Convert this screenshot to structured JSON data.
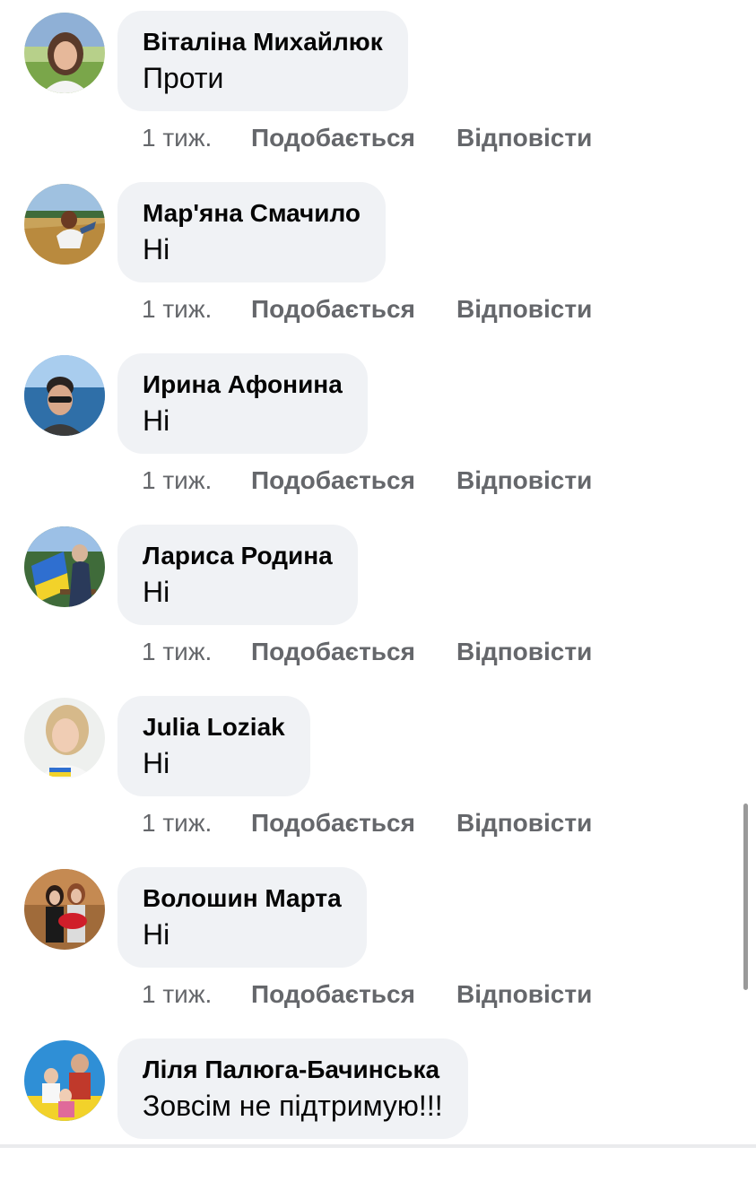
{
  "comments": [
    {
      "author": "Віталіна Михайлюк",
      "text": "Проти",
      "time": "1 тиж.",
      "like_label": "Подобається",
      "reply_label": "Відповісти"
    },
    {
      "author": "Мар'яна Смачило",
      "text": "Ні",
      "time": "1 тиж.",
      "like_label": "Подобається",
      "reply_label": "Відповісти"
    },
    {
      "author": "Ирина Афонина",
      "text": "Ні",
      "time": "1 тиж.",
      "like_label": "Подобається",
      "reply_label": "Відповісти"
    },
    {
      "author": "Лариса Родина",
      "text": "Ні",
      "time": "1 тиж.",
      "like_label": "Подобається",
      "reply_label": "Відповісти"
    },
    {
      "author": "Julia Loziak",
      "text": "Ні",
      "time": "1 тиж.",
      "like_label": "Подобається",
      "reply_label": "Відповісти"
    },
    {
      "author": "Волошин Марта",
      "text": "Ні",
      "time": "1 тиж.",
      "like_label": "Подобається",
      "reply_label": "Відповісти"
    },
    {
      "author": "Ліля Палюга-Бачинська",
      "text": "Зовсім не підтримую!!!",
      "time": "",
      "like_label": "",
      "reply_label": ""
    }
  ],
  "colors": {
    "bubble_bg": "#f0f2f5",
    "name_text": "#050505",
    "secondary_text": "#65676b",
    "scrollbar": "#9a9a9a"
  }
}
